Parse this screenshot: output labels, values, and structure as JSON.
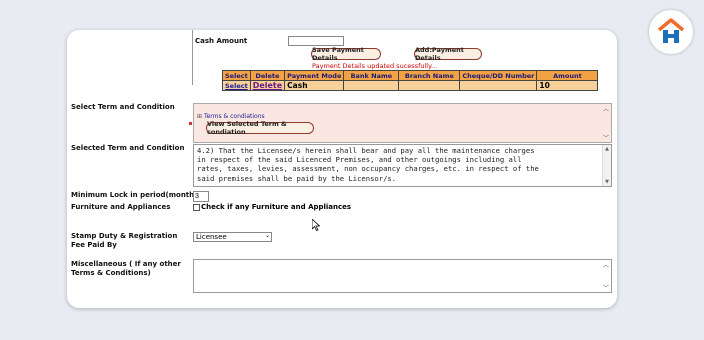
{
  "payment": {
    "cash_amount_label": "Cash Amount",
    "cash_amount_value": "",
    "save_button": "Save Payment Details",
    "add_button": "Add:Payment Details",
    "status_message": "Payment Details updated sucessfully...",
    "columns": [
      "Select",
      "Delete",
      "Payment Mode",
      "Bank Name",
      "Branch Name",
      "Cheque/DD Number",
      "Amount"
    ],
    "row": {
      "select": "Select",
      "delete": "Delete",
      "mode": "Cash",
      "bank": "",
      "branch": "",
      "cheque": "",
      "amount": "10"
    }
  },
  "terms": {
    "select_label": "Select Term and Condition",
    "tree_item": "Terms & condiations",
    "view_button": "View Selected Term & condiation",
    "selected_label": "Selected Term and Condition",
    "selected_text": "4.2) That the Licensee/s herein shall bear and pay all the maintenance charges\nin respect of the said Licenced Premises, and other outgoings including all\nrates, taxes, levies, assessment, non occupancy charges, etc. in respect of the\nsaid premises shall be paid by the Licensor/s."
  },
  "lockin": {
    "label": "Minimum Lock in period(months)",
    "value": "3"
  },
  "furniture": {
    "label": "Furniture and Appliances",
    "checkbox_label": "Check if any Furniture and Appliances"
  },
  "stamp": {
    "label": "Stamp Duty & Registration Fee Paid By",
    "selected": "Licensee"
  },
  "misc": {
    "label": "Miscellaneous ( If any other Terms & Conditions)",
    "value": ""
  },
  "colors": {
    "accent": "#f2a144",
    "status": "#cc0000",
    "brand_orange": "#f26b2a",
    "brand_blue": "#1d6fb8"
  },
  "icons": {
    "logo": "house-logo-icon",
    "cursor": "mouse-cursor-icon",
    "dropdown": "chevron-down-icon"
  }
}
